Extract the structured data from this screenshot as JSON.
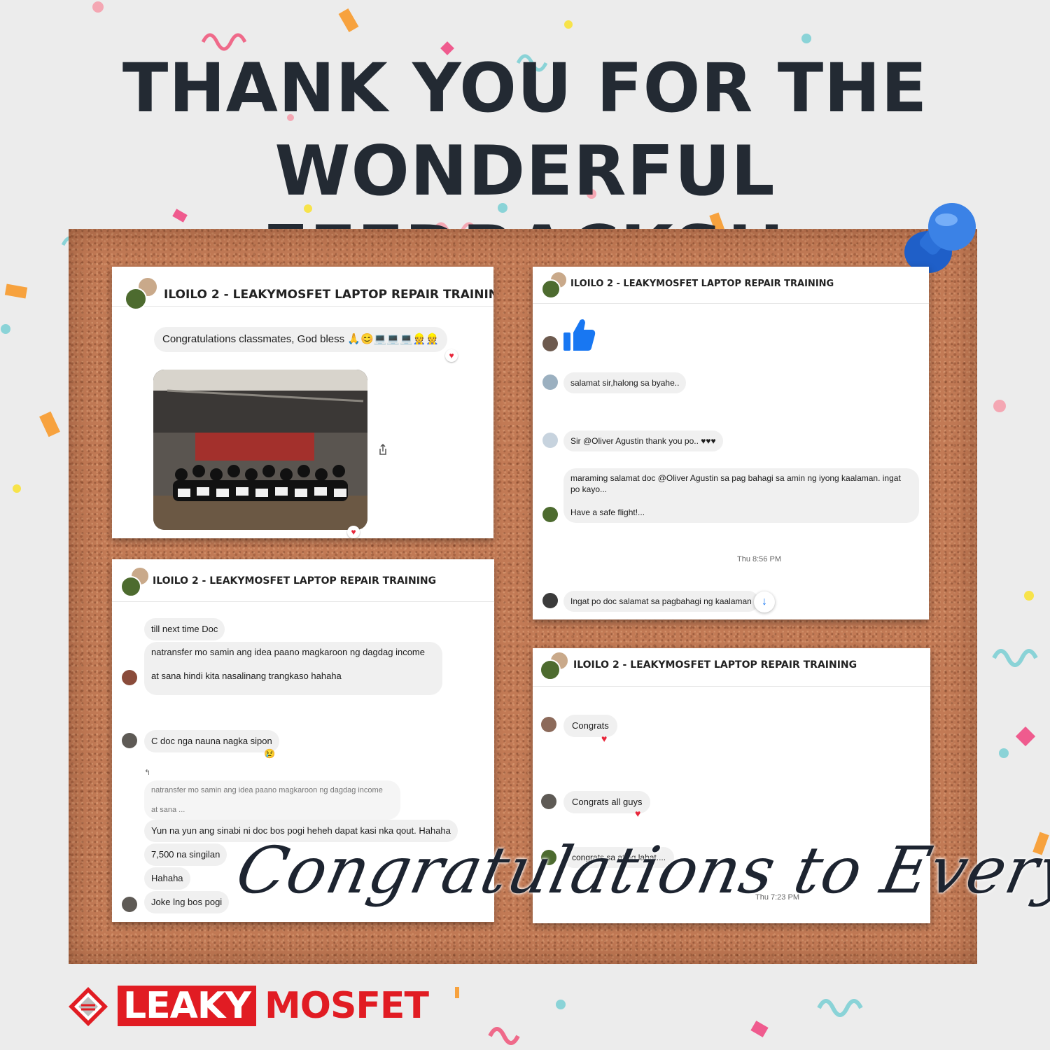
{
  "headline": {
    "line1": "THANK YOU FOR THE",
    "line2": "WONDERFUL FEEDBACKS!!"
  },
  "group_name": "ILOILO 2 - LEAKYMOSFET LAPTOP REPAIR TRAINING",
  "card1": {
    "message": "Congratulations classmates, God bless 🙏😊💻💻💻👷👷",
    "photo_alt": "group photo of training participants holding certificates"
  },
  "card2": {
    "msg1": "salamat sir,halong sa byahe..",
    "msg2": "Sir @Oliver Agustin thank you po.. ♥♥♥",
    "msg3": "maraming salamat doc @Oliver Agustin sa pag bahagi sa amin ng iyong kaalaman. ingat po kayo...",
    "msg4": "Have a safe flight!...",
    "timestamp": "Thu 8:56 PM",
    "msg5": "Ingat po doc salamat sa pagbahagi ng kaalaman"
  },
  "card3": {
    "msg1": "till next time Doc",
    "msg2": "natransfer mo samin ang idea  paano magkaroon ng dagdag income",
    "msg3": "at sana hindi kita nasalinang trangkaso hahaha",
    "msg4": "C doc nga nauna nagka sipon",
    "reply_quote1": "natransfer mo samin ang idea  paano magkaroon ng dagdag income",
    "reply_quote2": "at sana ...",
    "msg5": "Yun na yun ang sinabi ni doc bos pogi heheh dapat kasi nka qout. Hahaha",
    "msg6": "7,500 na singilan",
    "msg7": "Hahaha",
    "msg8": "Joke lng bos pogi"
  },
  "card4": {
    "msg1": "Congrats",
    "msg2": "Congrats all guys",
    "msg3": "congrats sa ating lahat....",
    "timestamp": "Thu 7:23 PM"
  },
  "script_text": "Congratulations to Everyone!",
  "logo": {
    "part1": "LEAKY",
    "part2": "MOSFET"
  },
  "colors": {
    "brand_red": "#e11c23",
    "heading": "#232a33",
    "cork": "#c27a55",
    "heart": "#e8263a",
    "like_blue": "#1877f2"
  }
}
